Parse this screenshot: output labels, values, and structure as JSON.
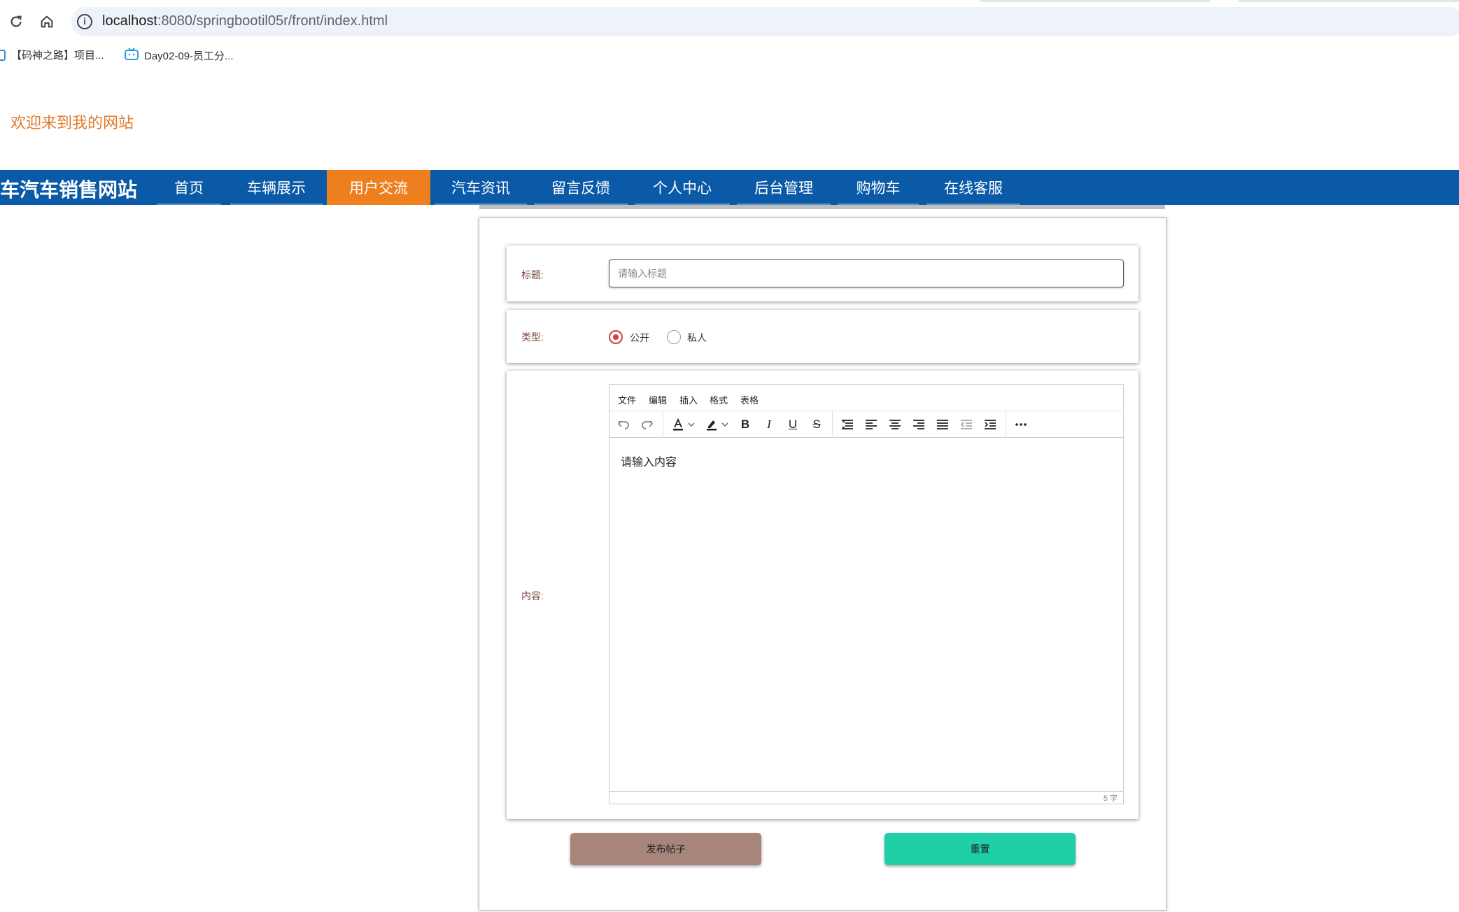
{
  "browser": {
    "url_host": "localhost",
    "url_rest": ":8080/springbootil05r/front/index.html",
    "bookmarks": [
      {
        "label": "【码神之路】项目..."
      },
      {
        "label": "Day02-09-员工分..."
      }
    ]
  },
  "header": {
    "welcome": "欢迎来到我的网站",
    "brand": "车汽车销售网站"
  },
  "nav": {
    "items": [
      "首页",
      "车辆展示",
      "用户交流",
      "汽车资讯",
      "留言反馈",
      "个人中心",
      "后台管理",
      "购物车",
      "在线客服"
    ],
    "active_index": 2
  },
  "form": {
    "title_label": "标题:",
    "title_placeholder": "请输入标题",
    "type_label": "类型:",
    "type_options": [
      "公开",
      "私人"
    ],
    "type_selected": "公开",
    "content_label": "内容:",
    "editor": {
      "menus": [
        "文件",
        "编辑",
        "插入",
        "格式",
        "表格"
      ],
      "content": "请输入内容",
      "word_count": "5 字"
    },
    "publish_button": "发布帖子",
    "reset_button": "重置"
  },
  "colors": {
    "nav_bg": "#0a5aa8",
    "nav_active": "#ee7f1f",
    "welcome": "#e07a2e",
    "publish_btn": "#a8857a",
    "reset_btn": "#1ecfa8"
  }
}
